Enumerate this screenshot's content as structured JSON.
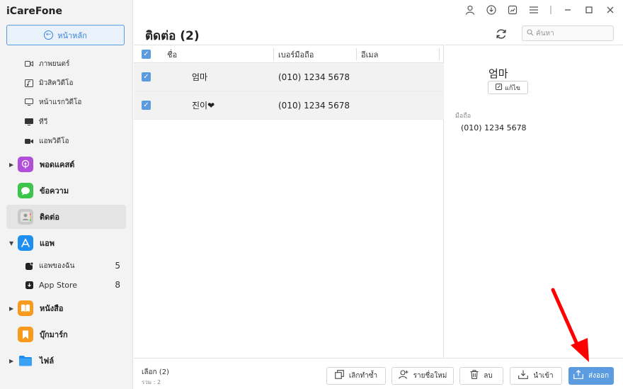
{
  "app": {
    "title": "iCareFone"
  },
  "sidebar": {
    "home_label": "หน้าหลัก",
    "sub_items": [
      {
        "label": "ภาพยนตร์",
        "icon": "video-icon"
      },
      {
        "label": "มิวสิควิดีโอ",
        "icon": "music-video-icon"
      },
      {
        "label": "หน้าแรกวิดีโอ",
        "icon": "monitor-icon"
      },
      {
        "label": "ทีวี",
        "icon": "tv-icon"
      },
      {
        "label": "แอพวิดีโอ",
        "icon": "camera-icon"
      }
    ],
    "categories": [
      {
        "label": "พอดแคสต์",
        "icon": "podcast-icon",
        "color": "#b14fd8"
      },
      {
        "label": "ข้อความ",
        "icon": "message-icon",
        "color": "#3cc54a"
      },
      {
        "label": "ติดต่อ",
        "icon": "contacts-icon",
        "color": "#c9c9c9"
      },
      {
        "label": "แอพ",
        "icon": "app-store-icon",
        "color": "#1e8ff0"
      },
      {
        "label": "หนังสือ",
        "icon": "books-icon",
        "color": "#f79a1e"
      },
      {
        "label": "บุ๊กมาร์ก",
        "icon": "bookmark-icon",
        "color": "#f79a1e"
      },
      {
        "label": "ไฟล์",
        "icon": "folder-icon",
        "color": "#1e8ff0"
      }
    ],
    "app_items": [
      {
        "label": "แอพของฉัน",
        "count": "5"
      },
      {
        "label": "App Store",
        "count": "8"
      }
    ]
  },
  "header": {
    "page_title": "ติดต่อ (2)",
    "search_placeholder": "ค้นหา"
  },
  "table": {
    "columns": [
      "ชื่อ",
      "เบอร์มือถือ",
      "อีเมล"
    ],
    "rows": [
      {
        "name": "엄마",
        "phone": "(010) 1234 5678",
        "email": ""
      },
      {
        "name": "진이❤",
        "phone": "(010) 1234 5678",
        "email": ""
      }
    ]
  },
  "detail": {
    "name": "엄마",
    "edit_label": "แก้ไข",
    "field_label": "มือถือ",
    "field_value": "(010) 1234 5678"
  },
  "footer": {
    "selected_label": "เลือก",
    "selected_count": "(2)",
    "total_text": "รวม : 2",
    "buttons": {
      "dedupe": "เลิกทำซ้ำ",
      "new_contact": "รายชื่อใหม่",
      "delete": "ลบ",
      "import": "นำเข้า",
      "export": "ส่งออก"
    }
  },
  "colors": {
    "accent": "#5b9be0",
    "annotation_arrow": "#ff0000"
  }
}
